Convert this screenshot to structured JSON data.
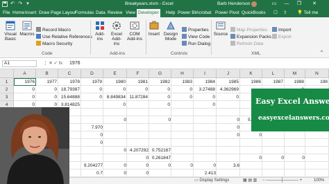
{
  "titlebar": {
    "autosave_icon": "save-icon",
    "file_name": "Breakyears.xlsm",
    "app_name": "Excel",
    "title_sep": " - ",
    "user_name": "Barb Henderson",
    "minimize": "—",
    "restore": "❐",
    "close": "✕"
  },
  "menu": {
    "tabs": [
      "File",
      "Home",
      "Insert",
      "Draw",
      "Page Layout",
      "Formulas",
      "Data",
      "Review",
      "View",
      "Developer",
      "Help",
      "Power BI",
      "Acrobat",
      "Power Pivot",
      "QuickBooks"
    ],
    "active": "Developer",
    "tell_me": "Tell me"
  },
  "ribbon": {
    "code": {
      "visual_basic": "Visual Basic",
      "macros": "Macros",
      "record_macro": "Record Macro",
      "use_relative": "Use Relative References",
      "macro_security": "Macro Security",
      "label": "Code"
    },
    "addins": {
      "addins": "Add-ins",
      "excel_addins": "Excel Add-ins",
      "com_addins": "COM Add-ins",
      "label": "Add-ins"
    },
    "controls": {
      "insert": "Insert",
      "design_mode": "Design Mode",
      "properties": "Properties",
      "view_code": "View Code",
      "run_dialog": "Run Dialog",
      "label": "Controls"
    },
    "xml": {
      "source": "Source",
      "map_properties": "Map Properties",
      "expansion_packs": "Expansion Packs",
      "refresh_data": "Refresh Data",
      "import": "Import",
      "export": "Export",
      "label": "XML"
    }
  },
  "formula_bar": {
    "name_box": "A1",
    "icons": "⋮  ✕  ✓  fx",
    "value": "1976"
  },
  "grid": {
    "columns": [
      "A",
      "B",
      "C",
      "D",
      "E",
      "F",
      "G",
      "H",
      "I",
      "J",
      "K",
      "L",
      "M",
      "N"
    ],
    "rows": [
      [
        "1976",
        "1977",
        "1978",
        "1979",
        "1980",
        "1981",
        "1982",
        "1983",
        "1984",
        "1985",
        "1986",
        "1987",
        "1988",
        "198"
      ],
      [
        "0",
        "0",
        "18.79387",
        "0",
        "0",
        "0",
        "0",
        "0",
        "3.27488",
        "4.362969",
        "",
        "",
        "0",
        ""
      ],
      [
        "0",
        "0",
        "15.64888",
        "0",
        "8.849834",
        "11.87284",
        "0",
        "0",
        "0",
        "0",
        "",
        "",
        "",
        ""
      ],
      [
        "0",
        "0",
        "3.814825",
        "",
        "0",
        "",
        "0",
        "",
        "0",
        "",
        "",
        "",
        "",
        ""
      ],
      [
        "",
        "",
        "",
        "",
        "",
        "",
        "",
        "",
        "",
        "",
        "",
        "",
        "",
        ""
      ],
      [
        "",
        "",
        "",
        "",
        "",
        "",
        "",
        "",
        "",
        "",
        "",
        "",
        "",
        ""
      ],
      [
        "",
        "",
        "",
        "",
        "",
        "",
        "",
        "",
        "",
        "",
        "",
        "",
        "",
        ""
      ],
      [
        "",
        "",
        "",
        "",
        "",
        "",
        "",
        "",
        "",
        "",
        "",
        "",
        "",
        ""
      ],
      [
        "",
        "",
        "",
        "",
        "",
        "",
        "",
        "",
        "",
        "",
        "",
        "",
        "",
        ""
      ],
      [
        "",
        "",
        "",
        "",
        "",
        "",
        "",
        "",
        "",
        "",
        "",
        "",
        "",
        ""
      ],
      [
        "",
        "",
        "",
        "",
        "",
        "",
        "",
        "",
        "",
        "",
        "",
        "",
        "",
        ""
      ],
      [
        "",
        "",
        "",
        "",
        "",
        "",
        "",
        "",
        "",
        "",
        "",
        "",
        "",
        ""
      ],
      [
        "",
        "",
        "",
        "",
        "",
        "",
        "",
        "",
        "",
        "",
        "",
        "",
        "",
        ""
      ]
    ],
    "overflow_values": [
      {
        "row": 5,
        "col": 4,
        "text": "0"
      },
      {
        "row": 5,
        "col": 6,
        "text": "0"
      },
      {
        "row": 5,
        "col": 9,
        "text": "0"
      },
      {
        "row": 5,
        "col": 10,
        "text": "5.3639"
      },
      {
        "row": 5,
        "col": 12,
        "text": "0"
      },
      {
        "row": 6,
        "col": 3,
        "text": "7.970"
      },
      {
        "row": 6,
        "col": 9,
        "text": "0"
      },
      {
        "row": 6,
        "col": 11,
        "text": "0"
      },
      {
        "row": 7,
        "col": 3,
        "text": "0"
      },
      {
        "row": 7,
        "col": 9,
        "text": "0"
      },
      {
        "row": 7,
        "col": 10,
        "text": "0"
      },
      {
        "row": 8,
        "col": 3,
        "text": "0"
      },
      {
        "row": 9,
        "col": 4,
        "text": "0"
      },
      {
        "row": 9,
        "col": 5,
        "text": "4.207292"
      },
      {
        "row": 9,
        "col": 6,
        "text": "0.752167"
      },
      {
        "row": 10,
        "col": 5,
        "text": "0"
      },
      {
        "row": 10,
        "col": 6,
        "text": "0.261847"
      },
      {
        "row": 10,
        "col": 10,
        "text": "0"
      },
      {
        "row": 10,
        "col": 11,
        "text": "0"
      },
      {
        "row": 10,
        "col": 12,
        "text": "0"
      },
      {
        "row": 11,
        "col": 3,
        "text": "9.204277"
      },
      {
        "row": 11,
        "col": 4,
        "text": "0"
      },
      {
        "row": 11,
        "col": 5,
        "text": "0"
      },
      {
        "row": 11,
        "col": 6,
        "text": "0"
      },
      {
        "row": 11,
        "col": 7,
        "text": "0"
      },
      {
        "row": 11,
        "col": 8,
        "text": "0"
      },
      {
        "row": 11,
        "col": 9,
        "text": "3.6"
      },
      {
        "row": 12,
        "col": 3,
        "text": "0.7"
      },
      {
        "row": 12,
        "col": 4,
        "text": "0"
      },
      {
        "row": 12,
        "col": 5,
        "text": "0"
      },
      {
        "row": 12,
        "col": 8,
        "text": "2.413"
      }
    ],
    "row_label_prefix": ""
  },
  "statusbar": {
    "display_settings": "Display Settings",
    "zoom": "100%"
  },
  "promo": {
    "line1": "Easy Excel Answers",
    "line2": "easyexcelanswers.com"
  },
  "colors": {
    "excel_green": "#217346",
    "promo_green": "#178a46"
  }
}
